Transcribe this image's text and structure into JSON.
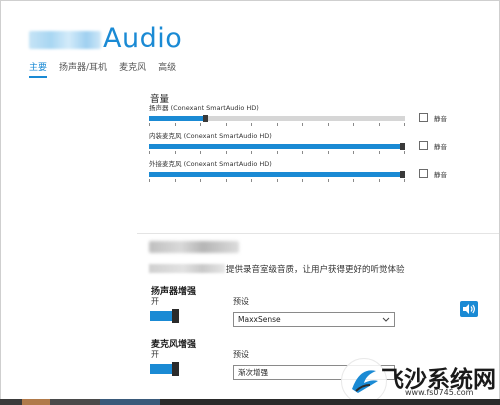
{
  "app": {
    "title": "Audio"
  },
  "tabs": [
    {
      "label": "主要",
      "active": true
    },
    {
      "label": "扬声器/耳机",
      "active": false
    },
    {
      "label": "麦克风",
      "active": false
    },
    {
      "label": "高级",
      "active": false
    }
  ],
  "volume": {
    "title": "音量",
    "mute_label": "静音",
    "devices": [
      {
        "label": "扬声器 (Conexant SmartAudio HD)",
        "level": 0.21,
        "muted": false
      },
      {
        "label": "内装麦克风 (Conexant SmartAudio HD)",
        "level": 0.98,
        "muted": false
      },
      {
        "label": "外接麦克风 (Conexant SmartAudio HD)",
        "level": 0.98,
        "muted": false
      }
    ]
  },
  "effects": {
    "description": "提供录音室级音质，让用户获得更好的听觉体验",
    "speaker_enhancement": {
      "title": "扬声器增强",
      "state": "开",
      "preset_label": "预设",
      "preset_value": "MaxxSense"
    },
    "mic_enhancement": {
      "title": "麦克风增强",
      "state": "开",
      "preset_label": "预设",
      "preset_value": "渐次增强"
    }
  },
  "watermark": {
    "name": "飞沙系统网",
    "url": "www.fs0745.com"
  },
  "colors": {
    "accent": "#1a8ad4",
    "thumb": "#3a3a3a",
    "track": "#d6d6d6"
  }
}
